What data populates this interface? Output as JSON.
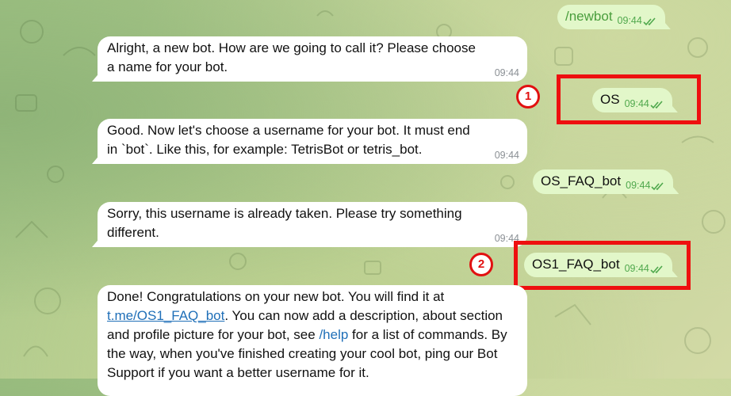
{
  "messages": {
    "m1": {
      "text": "/newbot",
      "time": "09:44"
    },
    "m2": {
      "text": "Alright, a new bot. How are we going to call it? Please choose a name for your bot.",
      "time": "09:44"
    },
    "m3": {
      "text": "OS",
      "time": "09:44"
    },
    "m4": {
      "text": "Good. Now let's choose a username for your bot. It must end in `bot`. Like this, for example: TetrisBot or tetris_bot.",
      "time": "09:44"
    },
    "m5": {
      "text": "OS_FAQ_bot",
      "time": "09:44"
    },
    "m6": {
      "text": "Sorry, this username is already taken. Please try something different.",
      "time": "09:44"
    },
    "m7": {
      "text": "OS1_FAQ_bot",
      "time": "09:44"
    },
    "m8": {
      "part1": "Done! Congratulations on your new bot. You will find it at ",
      "link": "t.me/OS1_FAQ_bot",
      "part2": ". You can now add a description, about section and profile picture for your bot, see ",
      "cmd": "/help",
      "part3": " for a list of commands. By the way, when you've finished creating your cool bot, ping our Bot Support if you want a better username for it."
    }
  },
  "annotations": {
    "step1": "1",
    "step2": "2",
    "highlight_color": "#ee0f0f"
  },
  "colors": {
    "incoming_bubble": "#ffffff",
    "outgoing_bubble": "#e2f7c9",
    "read_check": "#4fa84c",
    "link": "#1f6fb8"
  },
  "icons": [
    "double-check-icon"
  ]
}
